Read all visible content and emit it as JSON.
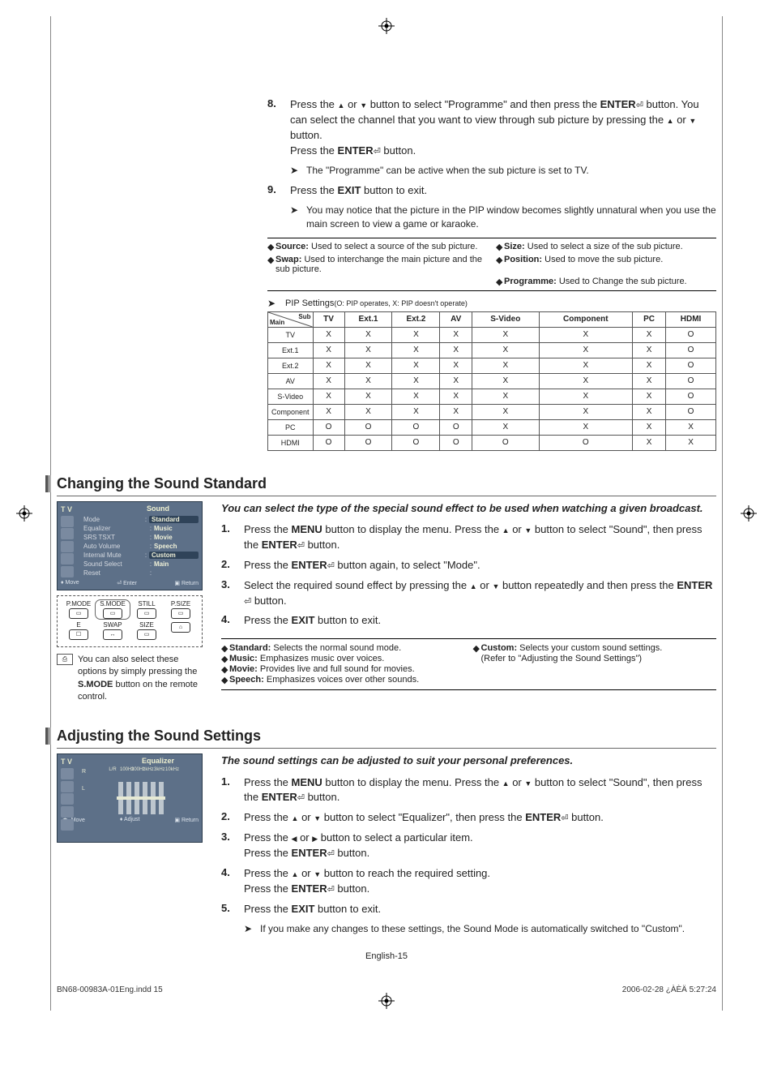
{
  "step8": {
    "num": "8.",
    "line1a": "Press the ",
    "line1b": " or ",
    "line1c": " button to select \"Programme\" and then press the ",
    "line2a": "ENTER",
    "line2b": " button. You can select the channel that you want to view through sub picture by pressing the ",
    "line2c": " or ",
    "line2d": " button.",
    "line3a": "Press the ",
    "line3b": "ENTER",
    "line3c": " button.",
    "note": "The \"Programme\" can be active when the sub picture is set to TV."
  },
  "step9": {
    "num": "9.",
    "line1a": "Press the ",
    "line1b": "EXIT",
    "line1c": " button to exit.",
    "note": "You may notice that the picture in the PIP window becomes slightly unnatural when you use the main screen to view a game or karaoke."
  },
  "defs": [
    {
      "label": "Source:",
      "text": " Used to select a source of the sub picture."
    },
    {
      "label": "Size:",
      "text": " Used to select a size of the sub picture."
    },
    {
      "label": "Swap:",
      "text": " Used to interchange the main picture and the sub picture."
    },
    {
      "label": "Position:",
      "text": " Used to move the sub picture."
    },
    {
      "label": "",
      "text": ""
    },
    {
      "label": "Programme:",
      "text": " Used to Change the sub picture."
    }
  ],
  "pip_label_a": "PIP Settings ",
  "pip_label_b": "(O: PIP operates, X: PIP doesn't operate)",
  "pip_table": {
    "main_label": "Main",
    "sub_label": "Sub",
    "cols": [
      "TV",
      "Ext.1",
      "Ext.2",
      "AV",
      "S-Video",
      "Component",
      "PC",
      "HDMI"
    ],
    "rows": [
      {
        "h": "TV",
        "c": [
          "X",
          "X",
          "X",
          "X",
          "X",
          "X",
          "X",
          "O"
        ]
      },
      {
        "h": "Ext.1",
        "c": [
          "X",
          "X",
          "X",
          "X",
          "X",
          "X",
          "X",
          "O"
        ]
      },
      {
        "h": "Ext.2",
        "c": [
          "X",
          "X",
          "X",
          "X",
          "X",
          "X",
          "X",
          "O"
        ]
      },
      {
        "h": "AV",
        "c": [
          "X",
          "X",
          "X",
          "X",
          "X",
          "X",
          "X",
          "O"
        ]
      },
      {
        "h": "S-Video",
        "c": [
          "X",
          "X",
          "X",
          "X",
          "X",
          "X",
          "X",
          "O"
        ]
      },
      {
        "h": "Component",
        "c": [
          "X",
          "X",
          "X",
          "X",
          "X",
          "X",
          "X",
          "O"
        ]
      },
      {
        "h": "PC",
        "c": [
          "O",
          "O",
          "O",
          "O",
          "X",
          "X",
          "X",
          "X"
        ]
      },
      {
        "h": "HDMI",
        "c": [
          "O",
          "O",
          "O",
          "O",
          "O",
          "O",
          "X",
          "X"
        ]
      }
    ]
  },
  "sound_section_title": "Changing the Sound Standard",
  "sound_intro": "You can select the type of the special sound effect to be used when watching a given broadcast.",
  "sound_steps": [
    {
      "num": "1.",
      "a": "Press the ",
      "b": "MENU",
      "c": " button to display the menu. Press the ",
      "d": " or ",
      "e": " button to select \"Sound\", then press the ",
      "f": "ENTER",
      "g": " button."
    },
    {
      "num": "2.",
      "a": "Press the ",
      "b": "ENTER",
      "c": " button again, to select \"Mode\"."
    },
    {
      "num": "3.",
      "a": "Select the required sound effect by pressing the ",
      "b": " or ",
      "c": " button repeatedly and then press the ",
      "d": "ENTER",
      "e": " button."
    },
    {
      "num": "4.",
      "a": "Press the ",
      "b": "EXIT",
      "c": " button to exit."
    }
  ],
  "osd_sound": {
    "tv": "T V",
    "title": "Sound",
    "rows": [
      {
        "lab": "Mode",
        "val": "Standard",
        "hi": true
      },
      {
        "lab": "Equalizer",
        "val": "Music"
      },
      {
        "lab": "SRS TSXT",
        "val": "Movie"
      },
      {
        "lab": "Auto Volume",
        "val": "Speech"
      },
      {
        "lab": "Internal Mute",
        "val": "Custom",
        "hi2": true
      },
      {
        "lab": "Sound Select",
        "val": "Main"
      },
      {
        "lab": "Reset",
        "val": ""
      }
    ],
    "footer": [
      "Move",
      "Enter",
      "Return"
    ]
  },
  "remote": {
    "row1": [
      "P.MODE",
      "S.MODE",
      "STILL",
      "P.SIZE"
    ],
    "row2": [
      "E",
      "SWAP",
      "SIZE",
      ""
    ]
  },
  "smode_note_a": "You can also select these options by simply pressing the ",
  "smode_note_b": "S.MODE",
  "smode_note_c": " button on the remote control.",
  "sound_modes_left": [
    {
      "b": "Standard:",
      "t": " Selects the normal sound mode."
    },
    {
      "b": "Music:",
      "t": " Emphasizes music over voices."
    },
    {
      "b": "Movie:",
      "t": " Provides live and full sound for movies."
    },
    {
      "b": "Speech:",
      "t": " Emphasizes voices over other sounds."
    }
  ],
  "sound_modes_right": [
    {
      "b": "Custom:",
      "t": " Selects your custom sound settings."
    },
    {
      "b": "",
      "t": "(Refer to \"Adjusting the Sound Settings\")"
    }
  ],
  "eq_section_title": "Adjusting the Sound Settings",
  "eq_intro": "The sound settings can be adjusted to suit your personal preferences.",
  "eq_steps": [
    {
      "num": "1.",
      "a": "Press the ",
      "b": "MENU",
      "c": " button to display the menu. Press the ",
      "d": " or ",
      "e": " button to select \"Sound\", then press the ",
      "f": "ENTER",
      "g": " button."
    },
    {
      "num": "2.",
      "a": "Press the ",
      "b": " or ",
      "c": " button to select \"Equalizer\", then press the ",
      "d": "ENTER",
      "e": " button."
    },
    {
      "num": "3.",
      "a": "Press the ",
      "b": " or ",
      "c": " button to select a particular item.",
      "d": "Press the ",
      "e": "ENTER",
      "f": " button."
    },
    {
      "num": "4.",
      "a": "Press the ",
      "b": " or ",
      "c": " button to reach the required setting.",
      "d": "Press the ",
      "e": "ENTER",
      "f": " button."
    },
    {
      "num": "5.",
      "a": "Press the ",
      "b": "EXIT",
      "c": " button to exit."
    }
  ],
  "eq_note": "If you make any changes to these settings, the Sound Mode is automatically switched to \"Custom\".",
  "osd_eq": {
    "tv": "T V",
    "title": "Equalizer",
    "labels": [
      "L/R",
      "100Hz",
      "300Hz",
      "1kHz",
      "3kHz",
      "10kHz"
    ],
    "footer": [
      "Move",
      "Adjust",
      "Return"
    ]
  },
  "page_num": "English-15",
  "footer_left": "BN68-00983A-01Eng.indd   15",
  "footer_right": "2006-02-28   ¿ÀÈÄ 5:27:24"
}
